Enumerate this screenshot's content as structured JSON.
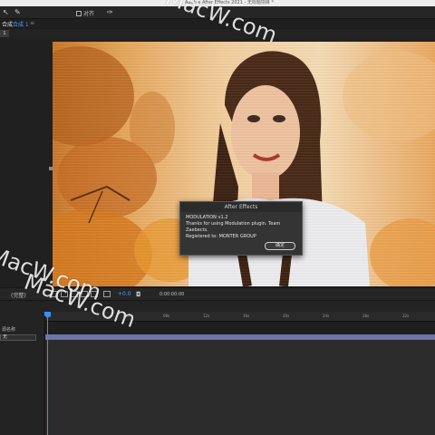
{
  "window": {
    "title": "Adob  e After Effects 2021 - 无标题项目 *"
  },
  "toolbar": {
    "snap_label": "对齐",
    "icons": [
      "selection-tool-icon",
      "pin-tool-icon",
      "pen-tool-icon"
    ]
  },
  "panel": {
    "tab_label": "合成",
    "comp_tab_label": "合成 1",
    "close_glyph": "≡",
    "sub_chip": "1"
  },
  "dialog": {
    "title": "After Effects",
    "line1": "MODULATION v1.2",
    "line2": "Thanks for using Modulation plugin. Team Zaebects.",
    "line3": "Registered to: MONTER GROUP",
    "ok_label": "确定"
  },
  "viewer": {
    "zoom_label": "(完整)",
    "exposure": "+0.0",
    "timecode": "0:00:00:00"
  },
  "timeline": {
    "ruler_ticks": [
      "0s",
      "04s",
      "08s",
      "12s",
      "16s",
      "20s",
      "24s",
      "28s",
      "32s",
      "36s"
    ],
    "layer_label": "源名称",
    "dropdown_value": "无"
  },
  "watermarks": [
    "MacW.com",
    "MacW.com",
    "MacW.com"
  ],
  "colors": {
    "accent": "#3b8cff",
    "work_area": "#6e75a8"
  }
}
